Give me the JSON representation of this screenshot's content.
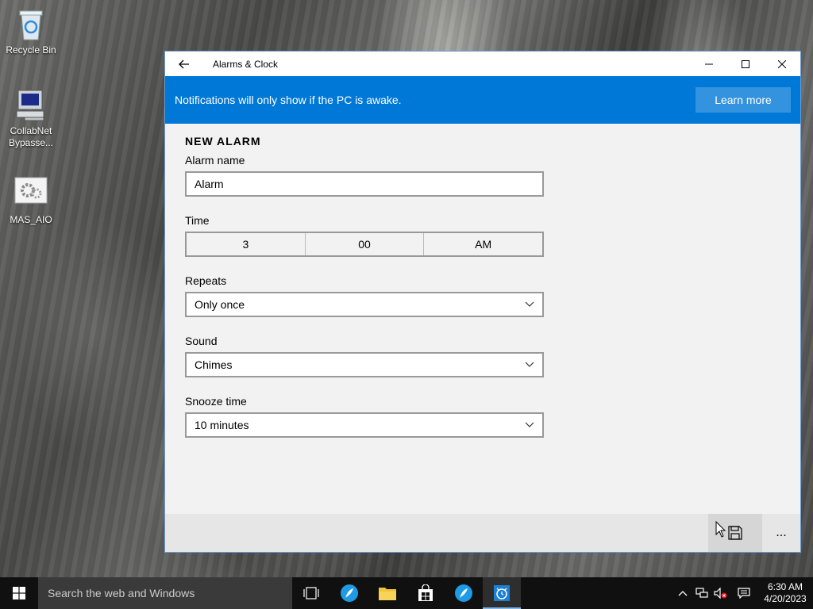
{
  "desktop": {
    "icons": [
      {
        "label": "Recycle Bin"
      },
      {
        "label": "CollabNet Bypasse..."
      },
      {
        "label": "MAS_AIO"
      }
    ]
  },
  "window": {
    "title": "Alarms & Clock",
    "banner": {
      "message": "Notifications will only show if the PC is awake.",
      "learn_more": "Learn more"
    },
    "form": {
      "heading": "NEW ALARM",
      "alarm_name_label": "Alarm name",
      "alarm_name_value": "Alarm",
      "time_label": "Time",
      "time_hour": "3",
      "time_minute": "00",
      "time_period": "AM",
      "repeats_label": "Repeats",
      "repeats_value": "Only once",
      "sound_label": "Sound",
      "sound_value": "Chimes",
      "snooze_label": "Snooze time",
      "snooze_value": "10 minutes"
    },
    "command_bar": {
      "more": "..."
    }
  },
  "taskbar": {
    "search_placeholder": "Search the web and Windows",
    "clock_time": "6:30 AM",
    "clock_date": "4/20/2023"
  },
  "colors": {
    "accent": "#0078d7",
    "taskbar": "#101010"
  }
}
